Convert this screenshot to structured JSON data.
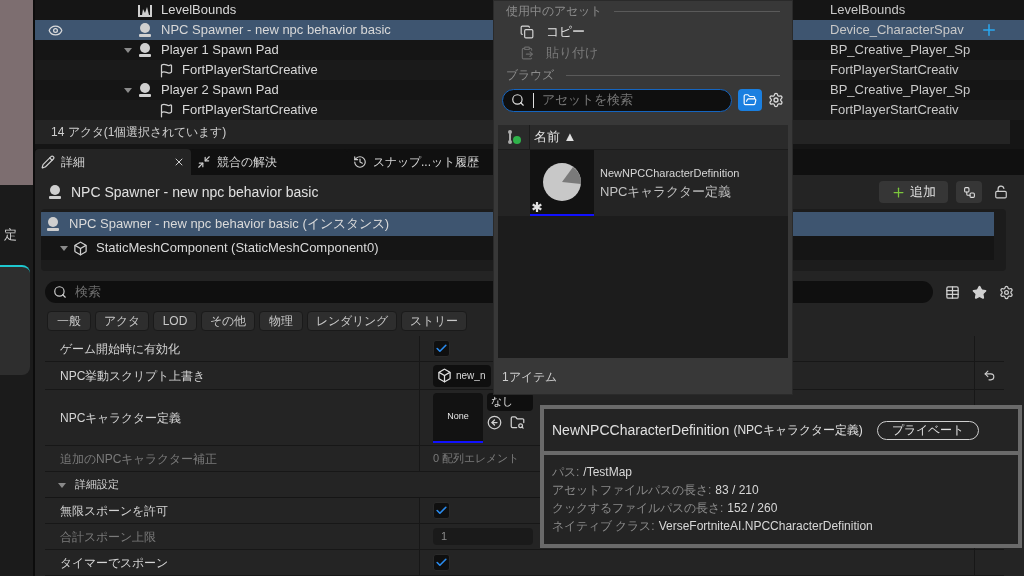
{
  "viewport_strip": {
    "label": "定"
  },
  "outliner": {
    "rows": [
      {
        "label": "LevelBounds",
        "type": "LevelBounds",
        "kind": "bounds",
        "selected": false
      },
      {
        "label": "NPC Spawner - new npc behavior basic",
        "type": "Device_CharacterSpav",
        "kind": "spawner",
        "selected": true
      },
      {
        "label": "Player 1 Spawn Pad",
        "type": "BP_Creative_Player_Sp",
        "kind": "spawner",
        "selected": false,
        "expanded": true,
        "children": [
          {
            "label": "FortPlayerStartCreative",
            "type": "FortPlayerStartCreativ",
            "kind": "player_start",
            "selected": false
          }
        ]
      },
      {
        "label": "Player 2 Spawn Pad",
        "type": "BP_Creative_Player_Sp",
        "kind": "spawner",
        "selected": false,
        "expanded": true,
        "children": [
          {
            "label": "FortPlayerStartCreative",
            "type": "FortPlayerStartCreativ",
            "kind": "player_start",
            "selected": false
          }
        ]
      }
    ],
    "status": "14 アクタ(1個選択されています)"
  },
  "details": {
    "tabs": [
      {
        "label": "詳細",
        "kind": "details",
        "selected": true
      },
      {
        "label": "競合の解決",
        "kind": "conflicts",
        "selected": false
      },
      {
        "label": "スナップ...ット履歴",
        "kind": "history",
        "selected": false
      }
    ],
    "title": "NPC Spawner - new npc behavior basic",
    "add_button": "追加",
    "components": [
      {
        "label": "NPC Spawner - new npc behavior basic (インスタンス)",
        "kind": "actor",
        "selected": true
      },
      {
        "label": "StaticMeshComponent (StaticMeshComponent0)",
        "kind": "mesh",
        "selected": false,
        "expanded": true
      }
    ],
    "search": {
      "placeholder": "検索"
    },
    "filters": [
      "一般",
      "アクタ",
      "LOD",
      "その他",
      "物理",
      "レンダリング",
      "ストリー"
    ],
    "properties": [
      {
        "kind": "checkbox",
        "label": "ゲーム開始時に有効化",
        "checked": true,
        "disabled": false
      },
      {
        "kind": "asset",
        "label": "NPC挙動スクリプト上書き",
        "value": "new_n",
        "disabled": false
      },
      {
        "kind": "asset_picker",
        "label": "NPCキャラクター定義",
        "thumbnail": "None",
        "value": "なし",
        "disabled": false
      },
      {
        "kind": "array",
        "label": "追加のNPCキャラクター補正",
        "value": "0 配列エレメント",
        "disabled": true
      },
      {
        "kind": "section",
        "label": "詳細設定",
        "expanded": true
      },
      {
        "kind": "checkbox",
        "label": "無限スポーンを許可",
        "checked": true,
        "disabled": false
      },
      {
        "kind": "number",
        "label": "合計スポーン上限",
        "value": "1",
        "disabled": true
      },
      {
        "kind": "checkbox",
        "label": "タイマーでスポーン",
        "checked": true,
        "disabled": false
      }
    ]
  },
  "asset_menu": {
    "in_use_header": "使用中のアセット",
    "actions": [
      {
        "label": "コピー",
        "kind": "copy",
        "disabled": false
      },
      {
        "label": "貼り付け",
        "kind": "paste",
        "disabled": true
      }
    ],
    "browse_header": "ブラウズ",
    "search": {
      "placeholder": "アセットを検索"
    },
    "column": "名前 ▲",
    "assets": [
      {
        "name": "NewNPCCharacterDefinition",
        "type": "NPCキャラクター定義"
      }
    ],
    "count": "1アイテム"
  },
  "tooltip": {
    "title": "NewNPCCharacterDefinition",
    "subtitle": "(NPCキャラクター定義)",
    "badge": "プライベート",
    "lines": [
      {
        "label": "パス:",
        "value": "/TestMap"
      },
      {
        "label": "アセットファイルパスの長さ:",
        "value": "83 / 210"
      },
      {
        "label": "クックするファイルパスの長さ:",
        "value": "152 / 260"
      },
      {
        "label": "ネイティブ クラス:",
        "value": "VerseFortniteAI.NPCCharacterDefinition"
      }
    ]
  }
}
